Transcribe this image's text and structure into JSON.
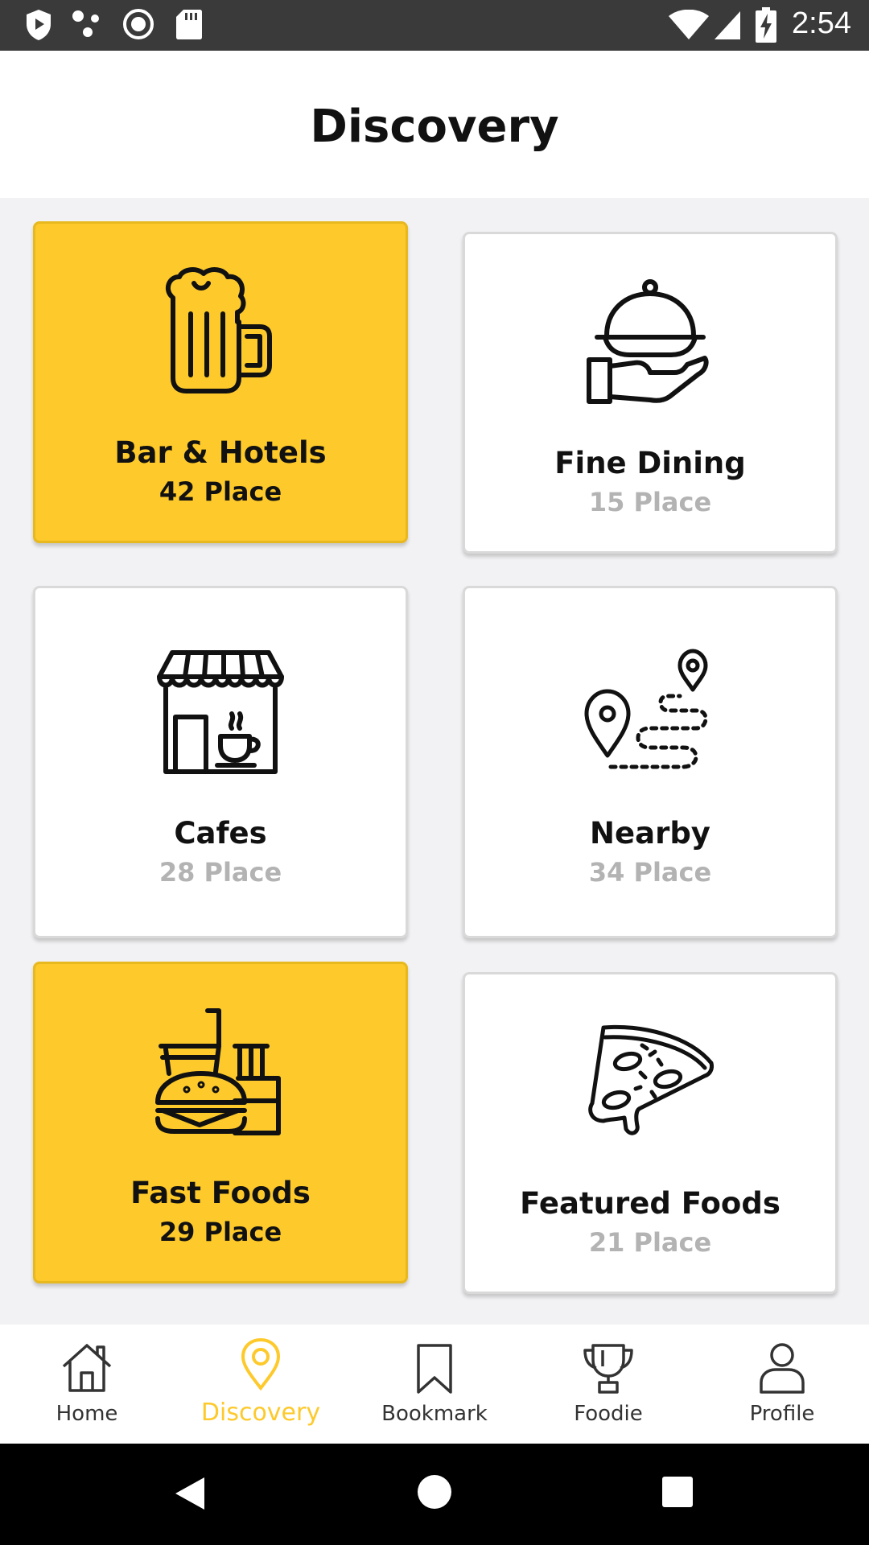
{
  "status_bar": {
    "time": "2:54",
    "left_icons": [
      "shield-icon",
      "dots-icon",
      "record-icon",
      "sd-card-icon"
    ],
    "right_icons": [
      "wifi-icon",
      "signal-icon",
      "battery-charging-icon"
    ]
  },
  "header": {
    "title": "Discovery"
  },
  "cards": [
    {
      "title": "Bar & Hotels",
      "count": "42 Place",
      "icon": "beer-mug-icon",
      "highlighted": true
    },
    {
      "title": "Fine Dining",
      "count": "15 Place",
      "icon": "cloche-serving-icon",
      "highlighted": false
    },
    {
      "title": "Cafes",
      "count": "28 Place",
      "icon": "cafe-shop-icon",
      "highlighted": false
    },
    {
      "title": "Nearby",
      "count": "34 Place",
      "icon": "route-map-icon",
      "highlighted": false
    },
    {
      "title": "Fast Foods",
      "count": "29 Place",
      "icon": "burger-fries-icon",
      "highlighted": true
    },
    {
      "title": "Featured Foods",
      "count": "21 Place",
      "icon": "pizza-slice-icon",
      "highlighted": false
    }
  ],
  "bottom_nav": {
    "items": [
      {
        "label": "Home",
        "icon": "home-icon"
      },
      {
        "label": "Discovery",
        "icon": "location-pin-icon",
        "active": true
      },
      {
        "label": "Bookmark",
        "icon": "bookmark-icon"
      },
      {
        "label": "Foodie",
        "icon": "trophy-icon"
      },
      {
        "label": "Profile",
        "icon": "person-icon"
      }
    ]
  },
  "colors": {
    "accent": "#fdc92b",
    "text": "#111111",
    "muted": "#b3b3b3",
    "background": "#f2f2f4"
  }
}
